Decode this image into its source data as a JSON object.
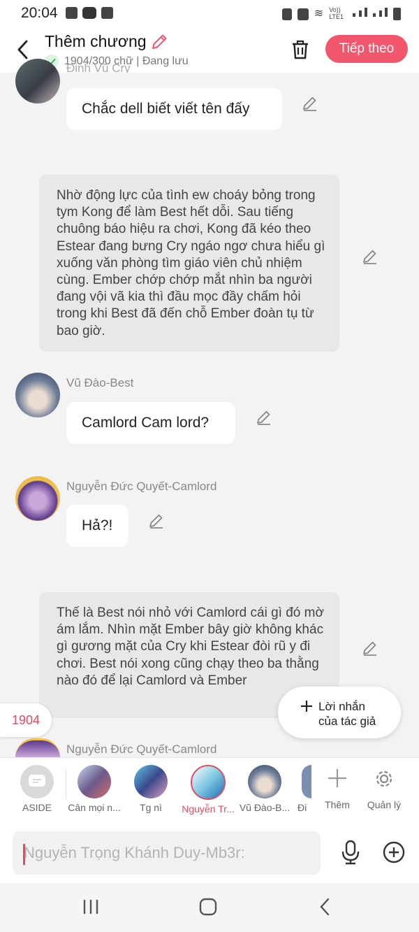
{
  "status": {
    "time": "20:04",
    "lte_label": "Vo)) LTE1"
  },
  "header": {
    "title": "Thêm chương",
    "subtitle": "1904/300 chữ | Đang lưu",
    "next_button": "Tiếp theo"
  },
  "messages": {
    "m1": {
      "name": "Đinh Vũ Cry",
      "text": "Chắc dell biết viết tên đấy"
    },
    "narr1": "Nhờ động lực của tình ew choáy bỏng trong tym Kong để làm Best hết dỗi. Sau tiếng chuông báo hiệu ra chơi, Kong đã kéo theo Estear đang bưng Cry ngáo ngơ chưa hiểu gì xuống văn phòng tìm giáo viên chủ nhiệm cùng. Ember chớp chớp mắt nhìn ba người đang vội vã kia thì đầu mọc đầy chấm hỏi trong khi Best đã đến chỗ Ember đoàn tụ từ bao giờ.",
    "m2": {
      "name": "Vũ Đào-Best",
      "text": "Camlord Cam lord?"
    },
    "m3": {
      "name": "Nguyễn Đức Quyết-Camlord",
      "text": "Hả?!"
    },
    "narr2": "Thế là Best nói nhỏ với Camlord cái gì đó mờ ám lắm. Nhìn mặt Ember bây giờ không khác gì gương mặt của Cry khi Estear đòi rũ y đi chơi. Best nói xong cũng chạy theo ba thằng nào đó để lại Camlord và Ember",
    "m4": {
      "name": "Nguyễn Đức Quyết-Camlord"
    }
  },
  "floating": {
    "word_count": "1904",
    "author_note_line1": "Lời nhắn",
    "author_note_line2": "của tác giả"
  },
  "characters": {
    "aside": "ASIDE",
    "c1": "Cân mọi n...",
    "c2": "Tg nì",
    "c3": "Nguyễn Tr...",
    "c4": "Vũ Đào-B...",
    "c5": "Đi",
    "add": "Thêm",
    "manage": "Quản lý"
  },
  "composer": {
    "placeholder": "Nguyễn Trọng Khánh Duy-Mb3r:"
  },
  "colors": {
    "accent": "#f2566d",
    "selected_text": "#e24b62"
  }
}
